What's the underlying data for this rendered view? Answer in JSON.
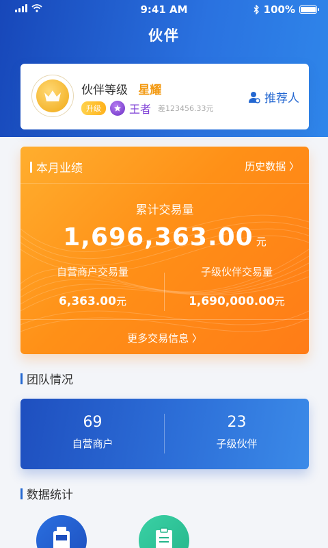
{
  "status_bar": {
    "time": "9:41 AM",
    "battery": "100%"
  },
  "header": {
    "title": "伙伴"
  },
  "level_card": {
    "label": "伙伴等级",
    "level": "星耀",
    "upgrade_badge": "升级",
    "next_level": "王者",
    "gap": "差123456.33元",
    "referrer": "推荐人"
  },
  "performance": {
    "title": "本月业绩",
    "history": "历史数据 〉",
    "total_label": "累计交易量",
    "total_value": "1,696,363.00",
    "unit": "元",
    "self_label": "自营商户交易量",
    "self_value": "6,363.00",
    "sub_label": "子级伙伴交易量",
    "sub_value": "1,690,000.00",
    "more": "更多交易信息 〉"
  },
  "team": {
    "section_title": "团队情况",
    "merchants_count": "69",
    "merchants_label": "自营商户",
    "partners_count": "23",
    "partners_label": "子级伙伴"
  },
  "stats": {
    "section_title": "数据统计"
  },
  "colors": {
    "primary": "#2367d1",
    "orange": "#ff9017",
    "gold": "#f39a13",
    "purple": "#7d3dd6",
    "green": "#2fc49a"
  }
}
